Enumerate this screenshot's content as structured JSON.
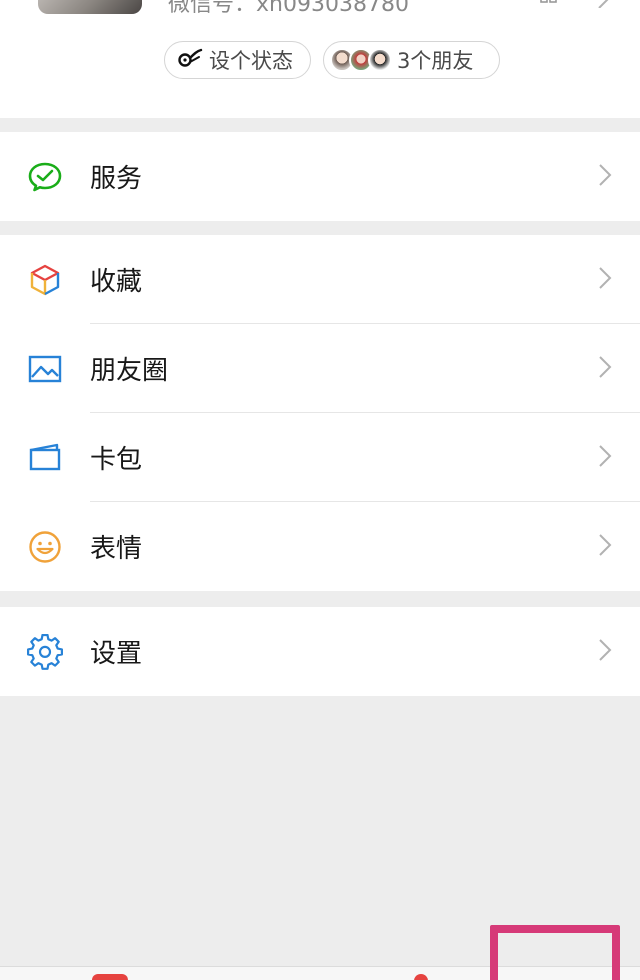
{
  "profile": {
    "wechat_id": "微信号：xh093038780",
    "status_pill": "设个状态",
    "friends_pill": "3个朋友"
  },
  "menu": {
    "services": "服务",
    "favorites": "收藏",
    "moments": "朋友圈",
    "cards": "卡包",
    "stickers": "表情",
    "settings": "设置"
  },
  "colors": {
    "services_icon": "#1aad19",
    "favorites_icon": "#f0b23a",
    "moments_icon": "#2782d7",
    "cards_icon": "#2782d7",
    "stickers_icon": "#f0a23a",
    "settings_icon": "#2782d7",
    "highlight": "#d63a78"
  }
}
